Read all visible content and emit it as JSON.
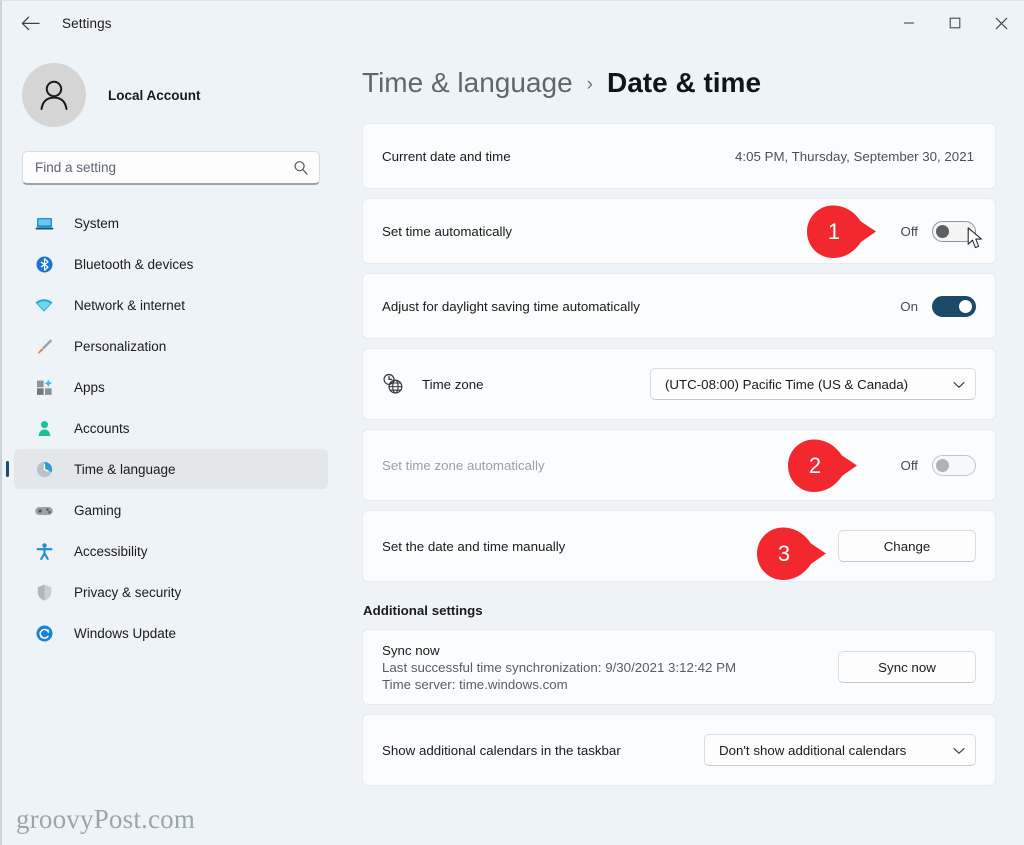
{
  "window": {
    "app_title": "Settings",
    "back_icon": "back-arrow-icon",
    "minimize_label": "–",
    "maximize_label": "☐",
    "close_label": "✕"
  },
  "sidebar": {
    "account_name": "Local Account",
    "avatar_icon": "person-avatar-icon",
    "search": {
      "placeholder": "Find a setting",
      "value": "",
      "icon": "search-icon"
    },
    "items": [
      {
        "label": "System",
        "icon": "laptop-icon",
        "selected": false
      },
      {
        "label": "Bluetooth & devices",
        "icon": "bluetooth-icon",
        "selected": false
      },
      {
        "label": "Network & internet",
        "icon": "wifi-icon",
        "selected": false
      },
      {
        "label": "Personalization",
        "icon": "paintbrush-icon",
        "selected": false
      },
      {
        "label": "Apps",
        "icon": "apps-grid-icon",
        "selected": false
      },
      {
        "label": "Accounts",
        "icon": "person-icon",
        "selected": false
      },
      {
        "label": "Time & language",
        "icon": "clock-globe-icon",
        "selected": true
      },
      {
        "label": "Gaming",
        "icon": "gamepad-icon",
        "selected": false
      },
      {
        "label": "Accessibility",
        "icon": "accessibility-icon",
        "selected": false
      },
      {
        "label": "Privacy & security",
        "icon": "shield-icon",
        "selected": false
      },
      {
        "label": "Windows Update",
        "icon": "update-refresh-icon",
        "selected": false
      }
    ],
    "watermark": "groovyPost.com"
  },
  "main": {
    "breadcrumb": {
      "parent": "Time & language",
      "separator": "›",
      "current": "Date & time"
    },
    "rows": {
      "current_datetime": {
        "label": "Current date and time",
        "value": "4:05 PM, Thursday, September 30, 2021"
      },
      "set_time_auto": {
        "label": "Set time automatically",
        "state": "Off",
        "callout": "1"
      },
      "dst_auto": {
        "label": "Adjust for daylight saving time automatically",
        "state": "On"
      },
      "time_zone": {
        "label": "Time zone",
        "icon": "clock-globe-icon",
        "value": "(UTC-08:00) Pacific Time (US & Canada)",
        "caret": "⌄"
      },
      "set_tz_auto": {
        "label": "Set time zone automatically",
        "state": "Off",
        "callout": "2"
      },
      "set_manually": {
        "label": "Set the date and time manually",
        "button": "Change",
        "callout": "3"
      }
    },
    "additional_settings": {
      "title": "Additional settings",
      "sync": {
        "title": "Sync now",
        "last_sync": "Last successful time synchronization: 9/30/2021 3:12:42 PM",
        "time_server": "Time server: time.windows.com",
        "button": "Sync now"
      },
      "calendars": {
        "label": "Show additional calendars in the taskbar",
        "value": "Don't show additional calendars",
        "caret": "⌄"
      }
    }
  },
  "colors": {
    "accent": "#1a4a68",
    "callout_red": "#f3282e",
    "page_bg": "#eef3f7",
    "card_bg": "#fbfcfd"
  }
}
